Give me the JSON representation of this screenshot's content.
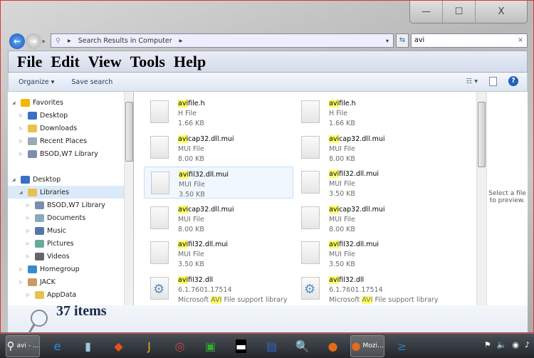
{
  "window": {
    "minimize": "—",
    "maximize": "☐",
    "close": "X"
  },
  "address": {
    "path": "Search Results in Computer",
    "search_value": "avi",
    "clear": "×"
  },
  "menu": [
    "File",
    "Edit",
    "View",
    "Tools",
    "Help"
  ],
  "toolbar": {
    "organize": "Organize ▾",
    "save_search": "Save search",
    "views": "☷ ▾",
    "help": "?"
  },
  "nav": [
    {
      "label": "Favorites",
      "icon": "star-icon",
      "color": "#f5b400",
      "indent": 0
    },
    {
      "label": "Desktop",
      "icon": "desktop-icon",
      "color": "#3a6fc4",
      "indent": 1
    },
    {
      "label": "Downloads",
      "icon": "folder-icon",
      "color": "#e8c150",
      "indent": 1
    },
    {
      "label": "Recent Places",
      "icon": "recent-icon",
      "color": "#9ab",
      "indent": 1
    },
    {
      "label": "BSOD,W7 Library",
      "icon": "library-icon",
      "color": "#7a8fb0",
      "indent": 1
    },
    {
      "label": "",
      "icon": "",
      "color": "",
      "indent": 0
    },
    {
      "label": "Desktop",
      "icon": "desktop-icon",
      "color": "#3a6fc4",
      "indent": 0
    },
    {
      "label": "Libraries",
      "icon": "libraries-icon",
      "color": "#e8c150",
      "indent": 1,
      "selected": true
    },
    {
      "label": "BSOD,W7 Library",
      "icon": "library-icon",
      "color": "#7a8fb0",
      "indent": 2
    },
    {
      "label": "Documents",
      "icon": "documents-icon",
      "color": "#8ab",
      "indent": 2
    },
    {
      "label": "Music",
      "icon": "music-icon",
      "color": "#57a",
      "indent": 2
    },
    {
      "label": "Pictures",
      "icon": "pictures-icon",
      "color": "#6a9",
      "indent": 2
    },
    {
      "label": "Videos",
      "icon": "videos-icon",
      "color": "#666",
      "indent": 2
    },
    {
      "label": "Homegroup",
      "icon": "homegroup-icon",
      "color": "#3a8ad0",
      "indent": 1
    },
    {
      "label": "JACK",
      "icon": "user-icon",
      "color": "#c96",
      "indent": 1
    },
    {
      "label": "AppData",
      "icon": "folder-icon",
      "color": "#e8c150",
      "indent": 2
    }
  ],
  "files": [
    {
      "hl": "avi",
      "rest": "file.h",
      "type": "H File",
      "size": "1.66 KB",
      "kind": "doc"
    },
    {
      "hl": "avi",
      "rest": "file.h",
      "type": "H File",
      "size": "1.66 KB",
      "kind": "doc"
    },
    {
      "hl": "avi",
      "rest": "cap32.dll.mui",
      "type": "MUI File",
      "size": "8.00 KB",
      "kind": "blank"
    },
    {
      "hl": "avi",
      "rest": "cap32.dll.mui",
      "type": "MUI File",
      "size": "8.00 KB",
      "kind": "blank"
    },
    {
      "hl": "avi",
      "rest": "fil32.dll.mui",
      "type": "MUI File",
      "size": "3.50 KB",
      "kind": "blank",
      "selected": true
    },
    {
      "hl": "avi",
      "rest": "fil32.dll.mui",
      "type": "MUI File",
      "size": "3.50 KB",
      "kind": "blank"
    },
    {
      "hl": "avi",
      "rest": "cap32.dll.mui",
      "type": "MUI File",
      "size": "8.00 KB",
      "kind": "blank"
    },
    {
      "hl": "avi",
      "rest": "cap32.dll.mui",
      "type": "MUI File",
      "size": "8.00 KB",
      "kind": "blank"
    },
    {
      "hl": "avi",
      "rest": "fil32.dll.mui",
      "type": "MUI File",
      "size": "3.50 KB",
      "kind": "blank"
    },
    {
      "hl": "avi",
      "rest": "fil32.dll.mui",
      "type": "MUI File",
      "size": "3.50 KB",
      "kind": "blank"
    },
    {
      "hl": "avi",
      "rest": "fil32.dll",
      "type": "6.1.7601.17514",
      "size": "Microsoft |AVI| File support library",
      "kind": "dll"
    },
    {
      "hl": "avi",
      "rest": "fil32.dll",
      "type": "6.1.7601.17514",
      "size": "Microsoft |AVI| File support library",
      "kind": "dll"
    }
  ],
  "preview_text": "Select a file to preview.",
  "details": {
    "count": "37 items"
  },
  "taskbar": {
    "explorer_label": "avi - ...",
    "firefox_label": "Mozi...",
    "apps": [
      {
        "name": "ie-icon",
        "glyph": "e",
        "color": "#2a8fe0"
      },
      {
        "name": "notepad-icon",
        "glyph": "▮",
        "color": "#9cd"
      },
      {
        "name": "acrobat-icon",
        "glyph": "◆",
        "color": "#e5501b"
      },
      {
        "name": "j-app-icon",
        "glyph": "J",
        "color": "#e0b020"
      },
      {
        "name": "compass-icon",
        "glyph": "◎",
        "color": "#c44"
      },
      {
        "name": "monitor-app-icon",
        "glyph": "▣",
        "color": "#3a3"
      },
      {
        "name": "cmd-icon",
        "glyph": "▬",
        "color": "#000"
      },
      {
        "name": "computer-icon",
        "glyph": "▤",
        "color": "#36c"
      },
      {
        "name": "search-doc-icon",
        "glyph": "🔍",
        "color": "#ccd"
      },
      {
        "name": "firefox-icon",
        "glyph": "●",
        "color": "#e66a1a"
      },
      {
        "name": "powershell-icon",
        "glyph": "≥",
        "color": "#2a7ab8"
      }
    ],
    "tray": [
      "⚑",
      "🔈",
      "◉",
      "♪"
    ]
  }
}
